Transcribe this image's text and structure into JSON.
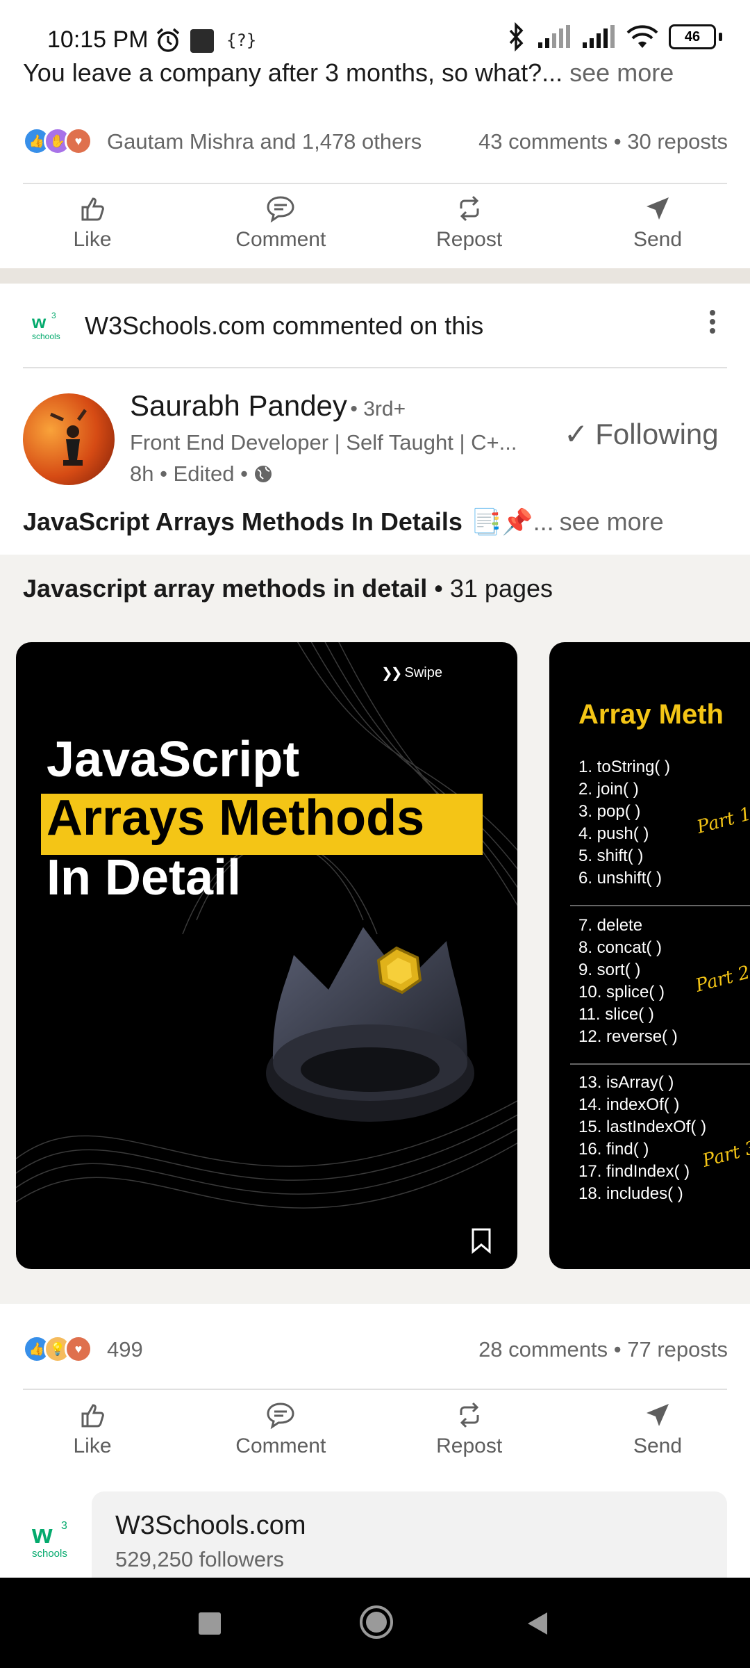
{
  "status_bar": {
    "time": "10:15 PM",
    "battery": "46"
  },
  "post1": {
    "text": "You leave a company after 3 months, so what?...",
    "see_more": "see more",
    "reactions_text": "Gautam Mishra and 1,478 others",
    "comments": "43 comments",
    "reposts": "30 reposts"
  },
  "actions": {
    "like": "Like",
    "comment": "Comment",
    "repost": "Repost",
    "send": "Send"
  },
  "post2": {
    "context_company": "W3Schools.com",
    "context_action": "commented on this",
    "author_name": "Saurabh Pandey",
    "degree": "• 3rd+",
    "headline": "Front End Developer | Self Taught | C+...",
    "meta": "8h • Edited •",
    "follow_label": "Following",
    "title": "JavaScript Arrays Methods In Details",
    "title_suffix": "...",
    "see_more": "see more",
    "document_title": "Javascript array methods in detail",
    "document_pages": "• 31 pages",
    "reaction_count": "499",
    "comments": "28 comments",
    "reposts": "77 reposts"
  },
  "slide1": {
    "swipe": "Swipe",
    "line1": "JavaScript",
    "line2": "Arrays Methods",
    "line3": "In Detail"
  },
  "slide2": {
    "title": "Array Meth",
    "group1": [
      "1. toString( )",
      "2. join( )",
      "3. pop( )",
      "4. push( )",
      "5. shift( )",
      "6. unshift( )"
    ],
    "group2": [
      "7. delete",
      "8. concat( )",
      "9. sort( )",
      "10. splice( )",
      "11. slice( )",
      "12. reverse( )"
    ],
    "group3": [
      "13. isArray( )",
      "14. indexOf( )",
      "15. lastIndexOf( )",
      "16. find( )",
      "17. findIndex( )",
      "18. includes( )"
    ],
    "part1": "Part 1",
    "part2": "Part 2",
    "part3": "Part 3"
  },
  "company_card": {
    "name": "W3Schools.com",
    "followers": "529,250 followers",
    "logo_text": "schools"
  },
  "colors": {
    "accent_yellow": "#f4c516",
    "w3_green": "#04aa6d",
    "like_blue": "#378fe9"
  }
}
